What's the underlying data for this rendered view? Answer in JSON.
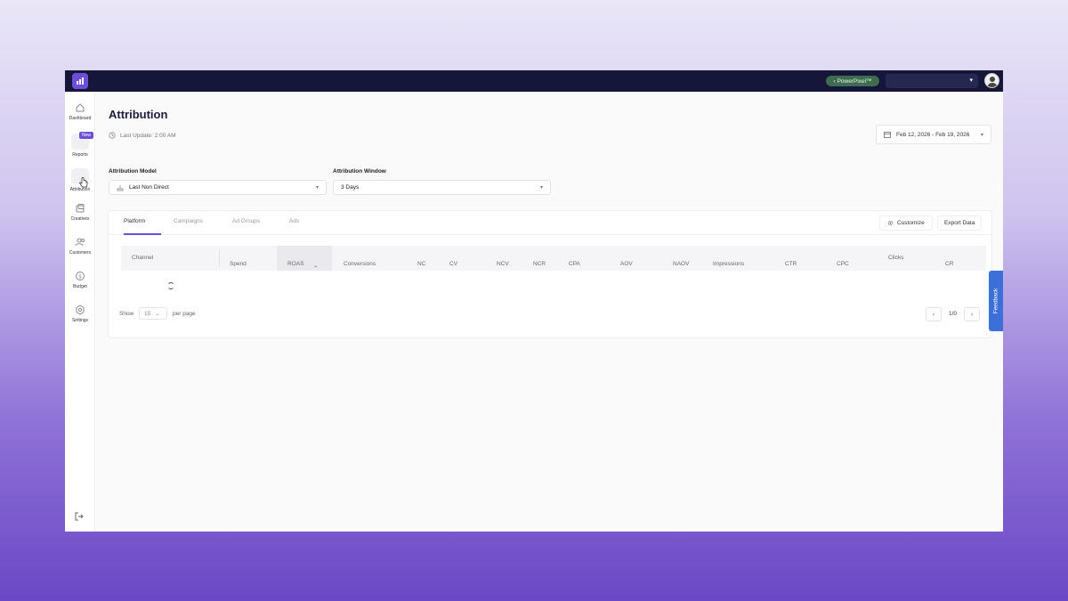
{
  "brand": {
    "logo_glyph": "📶",
    "accent": "#6c4fd8"
  },
  "topbar": {
    "pixel_pill": "PowerPixel™",
    "account_caret": "▾"
  },
  "sidebar": {
    "items": [
      {
        "label": "Dashboard",
        "icon": "home-icon"
      },
      {
        "label": "Reports",
        "icon": "reports-icon",
        "badge": "New"
      },
      {
        "label": "Attribution",
        "icon": "attribution-icon"
      },
      {
        "label": "Creatives",
        "icon": "creatives-icon"
      },
      {
        "label": "Customers",
        "icon": "customers-icon"
      },
      {
        "label": "Budget",
        "icon": "budget-icon"
      },
      {
        "label": "Settings",
        "icon": "settings-icon"
      }
    ]
  },
  "header": {
    "title": "Attribution",
    "last_update": "Last Update: 2:00 AM",
    "date_range": "Feb 12, 2026 - Feb 19, 2026"
  },
  "filters": {
    "model_label": "Attribution Model",
    "model_value": "Last Non Direct",
    "window_label": "Attribution Window",
    "window_value": "3 Days"
  },
  "tabs": [
    "Platform",
    "Campaigns",
    "Ad Groups",
    "Ads"
  ],
  "actions": {
    "customize": "Customize",
    "export": "Export Data"
  },
  "table": {
    "columns": [
      "Channel",
      "Spend",
      "ROAS",
      "Conversions",
      "NC",
      "CV",
      "NCV",
      "NCR",
      "CPA",
      "AOV",
      "NAOV",
      "Impressions",
      "CTR",
      "CPC",
      "Clicks",
      "CR"
    ],
    "sort_glyph": "⌄"
  },
  "pagination": {
    "show_label": "Show",
    "per_page_value": "15",
    "per_page_label": "per page",
    "page_text": "1/0",
    "prev": "‹",
    "next": "›"
  },
  "feedback": "Feedback"
}
